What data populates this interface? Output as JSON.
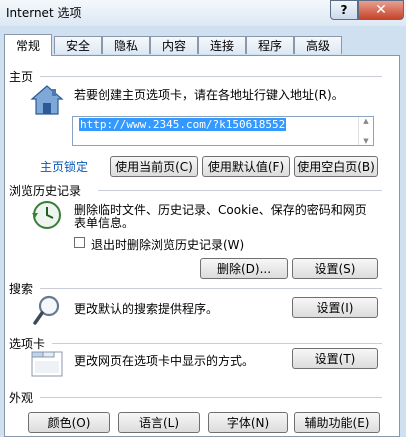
{
  "window": {
    "title": "Internet 选项",
    "help_label": "?",
    "close_label": "✕"
  },
  "tabs": [
    {
      "label": "常规"
    },
    {
      "label": "安全"
    },
    {
      "label": "隐私"
    },
    {
      "label": "内容"
    },
    {
      "label": "连接"
    },
    {
      "label": "程序"
    },
    {
      "label": "高级"
    }
  ],
  "home": {
    "section": "主页",
    "description": "若要创建主页选项卡，请在各地址行键入地址(R)。",
    "url_value": "http://www.2345.com/?k150618552",
    "locked_link": "主页锁定",
    "use_current": "使用当前页(C)",
    "use_default": "使用默认值(F)",
    "use_blank": "使用空白页(B)",
    "icon": "house-icon"
  },
  "history": {
    "section": "浏览历史记录",
    "description_line1": "删除临时文件、历史记录、Cookie、保存的密码和网页",
    "description_line2": "表单信息。",
    "checkbox_label": "退出时删除浏览历史记录(W)",
    "delete_button": "删除(D)...",
    "settings_button": "设置(S)",
    "icon": "history-clock-icon"
  },
  "search": {
    "section": "搜索",
    "description": "更改默认的搜索提供程序。",
    "settings_button": "设置(I)",
    "icon": "magnifier-icon"
  },
  "tabs_section": {
    "section": "选项卡",
    "description": "更改网页在选项卡中显示的方式。",
    "settings_button": "设置(T)",
    "icon": "tab-window-icon"
  },
  "appearance": {
    "section": "外观",
    "colors_button": "颜色(O)",
    "languages_button": "语言(L)",
    "fonts_button": "字体(N)",
    "accessibility_button": "辅助功能(E)"
  }
}
